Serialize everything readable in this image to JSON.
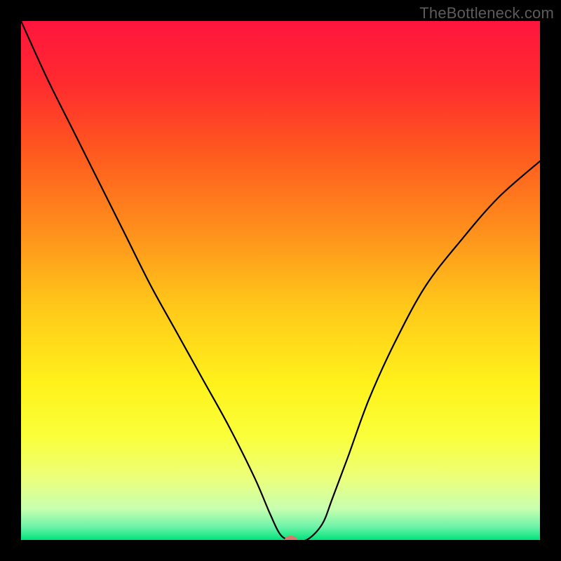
{
  "watermark": "TheBottleneck.com",
  "chart_data": {
    "type": "line",
    "title": "",
    "xlabel": "",
    "ylabel": "",
    "xlim": [
      0,
      100
    ],
    "ylim": [
      0,
      100
    ],
    "background_gradient": {
      "stops": [
        {
          "offset": 0.0,
          "color": "#ff153e"
        },
        {
          "offset": 0.12,
          "color": "#ff2b2f"
        },
        {
          "offset": 0.25,
          "color": "#ff581f"
        },
        {
          "offset": 0.4,
          "color": "#ff8e1c"
        },
        {
          "offset": 0.55,
          "color": "#ffc81a"
        },
        {
          "offset": 0.7,
          "color": "#fff21b"
        },
        {
          "offset": 0.8,
          "color": "#faff3a"
        },
        {
          "offset": 0.88,
          "color": "#ecff7a"
        },
        {
          "offset": 0.94,
          "color": "#c8ffb0"
        },
        {
          "offset": 0.975,
          "color": "#6cf3a8"
        },
        {
          "offset": 1.0,
          "color": "#00e47a"
        }
      ]
    },
    "series": [
      {
        "name": "bottleneck-curve",
        "color": "#000000",
        "x": [
          0,
          5,
          10,
          15,
          20,
          25,
          30,
          35,
          40,
          45,
          48,
          50,
          52,
          55,
          58,
          60,
          63,
          67,
          72,
          78,
          85,
          92,
          100
        ],
        "y": [
          100,
          89,
          79,
          69,
          59,
          49,
          40,
          31,
          22,
          12,
          5,
          1,
          0,
          0,
          3,
          8,
          16,
          27,
          38,
          49,
          58,
          66,
          73
        ]
      }
    ],
    "marker": {
      "name": "optimal-point",
      "x": 52,
      "y": 0,
      "color": "#d77a6c",
      "rx": 9,
      "ry": 6
    }
  }
}
